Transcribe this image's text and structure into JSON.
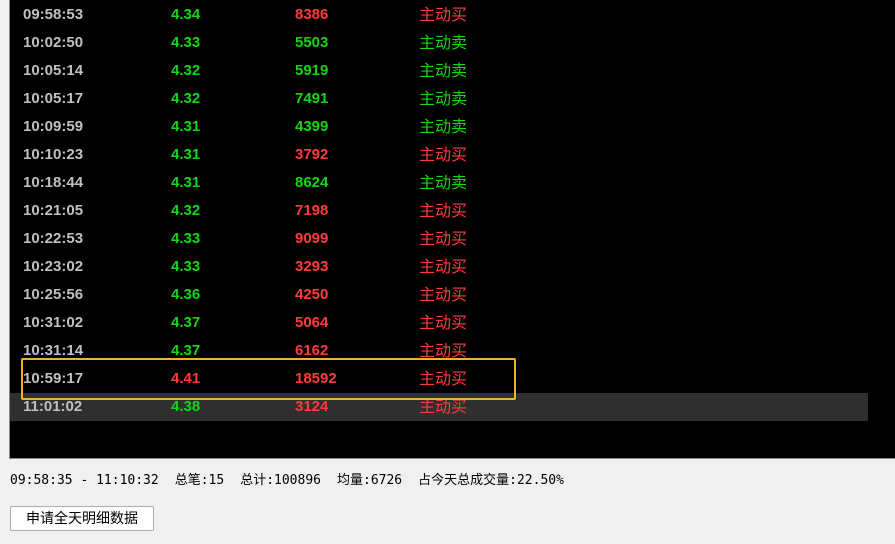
{
  "ticks": [
    {
      "time": "09:58:53",
      "price": "4.34",
      "price_dir": "down",
      "volume": "8386",
      "vol_dir": "up",
      "direction": "主动买",
      "direction_type": "up"
    },
    {
      "time": "10:02:50",
      "price": "4.33",
      "price_dir": "down",
      "volume": "5503",
      "vol_dir": "down",
      "direction": "主动卖",
      "direction_type": "down"
    },
    {
      "time": "10:05:14",
      "price": "4.32",
      "price_dir": "down",
      "volume": "5919",
      "vol_dir": "down",
      "direction": "主动卖",
      "direction_type": "down"
    },
    {
      "time": "10:05:17",
      "price": "4.32",
      "price_dir": "down",
      "volume": "7491",
      "vol_dir": "down",
      "direction": "主动卖",
      "direction_type": "down"
    },
    {
      "time": "10:09:59",
      "price": "4.31",
      "price_dir": "down",
      "volume": "4399",
      "vol_dir": "down",
      "direction": "主动卖",
      "direction_type": "down"
    },
    {
      "time": "10:10:23",
      "price": "4.31",
      "price_dir": "down",
      "volume": "3792",
      "vol_dir": "up",
      "direction": "主动买",
      "direction_type": "up"
    },
    {
      "time": "10:18:44",
      "price": "4.31",
      "price_dir": "down",
      "volume": "8624",
      "vol_dir": "down",
      "direction": "主动卖",
      "direction_type": "down"
    },
    {
      "time": "10:21:05",
      "price": "4.32",
      "price_dir": "down",
      "volume": "7198",
      "vol_dir": "up",
      "direction": "主动买",
      "direction_type": "up"
    },
    {
      "time": "10:22:53",
      "price": "4.33",
      "price_dir": "down",
      "volume": "9099",
      "vol_dir": "up",
      "direction": "主动买",
      "direction_type": "up"
    },
    {
      "time": "10:23:02",
      "price": "4.33",
      "price_dir": "down",
      "volume": "3293",
      "vol_dir": "up",
      "direction": "主动买",
      "direction_type": "up"
    },
    {
      "time": "10:25:56",
      "price": "4.36",
      "price_dir": "down",
      "volume": "4250",
      "vol_dir": "up",
      "direction": "主动买",
      "direction_type": "up"
    },
    {
      "time": "10:31:02",
      "price": "4.37",
      "price_dir": "down",
      "volume": "5064",
      "vol_dir": "up",
      "direction": "主动买",
      "direction_type": "up"
    },
    {
      "time": "10:31:14",
      "price": "4.37",
      "price_dir": "down",
      "volume": "6162",
      "vol_dir": "up",
      "direction": "主动买",
      "direction_type": "up"
    },
    {
      "time": "10:59:17",
      "price": "4.41",
      "price_dir": "up",
      "volume": "18592",
      "vol_dir": "up",
      "direction": "主动买",
      "direction_type": "up"
    },
    {
      "time": "11:01:02",
      "price": "4.38",
      "price_dir": "down",
      "volume": "3124",
      "vol_dir": "up",
      "direction": "主动买",
      "direction_type": "up"
    }
  ],
  "selected_row_index": 14,
  "highlighted_row_index": 13,
  "summary": {
    "time_range": "09:58:35 - 11:10:32",
    "total_trades": "总笔:15",
    "total_volume": "总计:100896",
    "avg_volume": "均量:6726",
    "day_ratio": "占今天总成交量:22.50%"
  },
  "request_button_label": "申请全天明细数据",
  "colors": {
    "up": "#ff3b3b",
    "down": "#16d416",
    "highlight": "#f0b030",
    "background": "#000000"
  }
}
